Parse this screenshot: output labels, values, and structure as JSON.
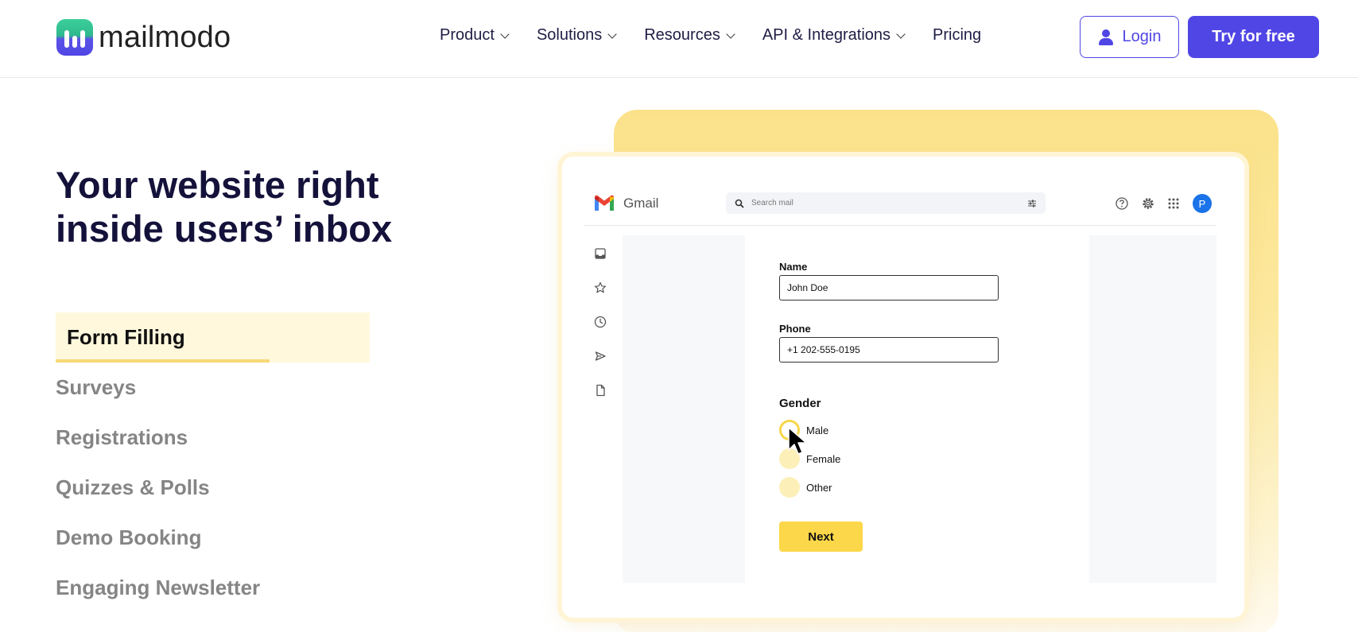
{
  "brand": {
    "name": "mailmodo"
  },
  "nav": [
    {
      "label": "Product",
      "has_dropdown": true
    },
    {
      "label": "Solutions",
      "has_dropdown": true
    },
    {
      "label": "Resources",
      "has_dropdown": true
    },
    {
      "label": "API & Integrations",
      "has_dropdown": true
    },
    {
      "label": "Pricing",
      "has_dropdown": false
    }
  ],
  "header": {
    "login_label": "Login",
    "try_label": "Try for free"
  },
  "hero": {
    "title": "Your website right inside users’ inbox"
  },
  "features": [
    {
      "label": "Form Filling",
      "active": true,
      "progress": 0.68
    },
    {
      "label": "Surveys",
      "active": false
    },
    {
      "label": "Registrations",
      "active": false
    },
    {
      "label": "Quizzes & Polls",
      "active": false
    },
    {
      "label": "Demo Booking",
      "active": false
    },
    {
      "label": "Engaging Newsletter",
      "active": false
    }
  ],
  "gmail": {
    "app_name": "Gmail",
    "search_placeholder": "Search mail",
    "avatar_initial": "P",
    "form": {
      "name_label": "Name",
      "name_value": "John Doe",
      "phone_label": "Phone",
      "phone_value": "+1 202-555-0195",
      "gender_label": "Gender",
      "gender_options": [
        "Male",
        "Female",
        "Other"
      ],
      "next_label": "Next"
    }
  },
  "colors": {
    "brand_primary": "#5046e5",
    "heading": "#14123a",
    "active_feature_bg": "#fff8dc",
    "accent_yellow": "#fcd749"
  }
}
